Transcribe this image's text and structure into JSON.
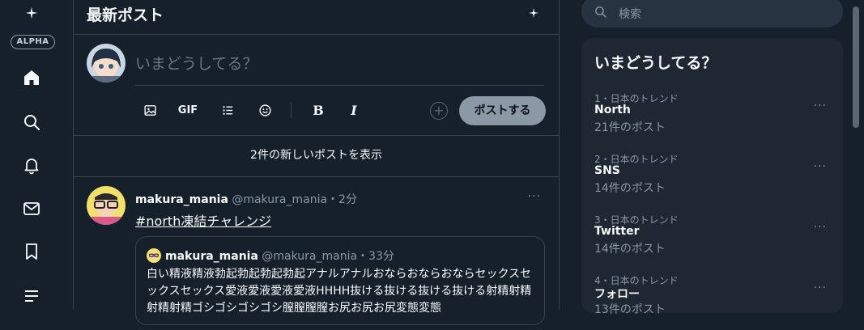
{
  "sidebar": {
    "badge": "ALPHA",
    "nav": [
      "home-icon",
      "search-icon",
      "bell-icon",
      "mail-icon",
      "bookmark-icon",
      "list-icon"
    ]
  },
  "header": {
    "title": "最新ポスト"
  },
  "compose": {
    "placeholder": "いまどうしてる？",
    "tools": {
      "gif": "GIF",
      "bold": "B",
      "italic": "I",
      "add": "+"
    },
    "post_button": "ポストする"
  },
  "new_posts": "2件の新しいポストを表示",
  "post": {
    "user": "makura_mania",
    "handle": "@makura_mania",
    "sep": "・",
    "time": "2分",
    "text": "#north凍結チャレンジ",
    "more": "···",
    "quote": {
      "user": "makura_mania",
      "handle": "@makura_mania",
      "sep": "・",
      "time": "33分",
      "text": "白い精液精液勃起勃起勃起勃起アナルアナルおならおならおならセックスセックスセックス愛液愛液愛液愛液HHHH抜ける抜ける抜ける抜ける射精射精射精射精ゴシゴシゴシゴシ膣膣膣膣お尻お尻お尻変態変態"
    }
  },
  "search": {
    "placeholder": "検索"
  },
  "trends": {
    "title": "いまどうしてる？",
    "items": [
      {
        "meta": "1・日本のトレンド",
        "name": "North",
        "count": "21件のポスト"
      },
      {
        "meta": "2・日本のトレンド",
        "name": "SNS",
        "count": "14件のポスト"
      },
      {
        "meta": "3・日本のトレンド",
        "name": "Twitter",
        "count": "14件のポスト"
      },
      {
        "meta": "4・日本のトレンド",
        "name": "フォロー",
        "count": "13件のポスト"
      }
    ],
    "more": "···"
  },
  "colors": {
    "background": "#15202b",
    "panel": "#1e2732",
    "border": "#38444d",
    "muted": "#8b98a5",
    "post_button": "#8b98a5"
  }
}
